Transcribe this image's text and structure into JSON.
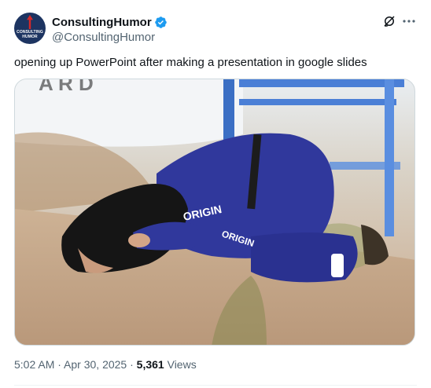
{
  "author": {
    "display_name": "ConsultingHumor",
    "handle": "@ConsultingHumor",
    "avatar_text": "CONSULTING HUMOR",
    "verified": true,
    "verified_color": "#1d9bf0"
  },
  "tweet": {
    "text": "opening up PowerPoint after making a presentation in google slides"
  },
  "media": {
    "suit_print_1": "ORIGIN",
    "suit_print_2": "ORIGIN",
    "background_print": "A R D"
  },
  "meta": {
    "time": "5:02 AM",
    "separator_1": " · ",
    "date": "Apr 30, 2025",
    "separator_2": " · ",
    "views_count": "5,361",
    "views_label": " Views"
  },
  "icons": {
    "grok": "grok-icon",
    "more": "more-icon",
    "verified": "verified-badge-icon"
  },
  "colors": {
    "text_primary": "#0f1419",
    "text_secondary": "#536471",
    "accent": "#1d9bf0"
  }
}
